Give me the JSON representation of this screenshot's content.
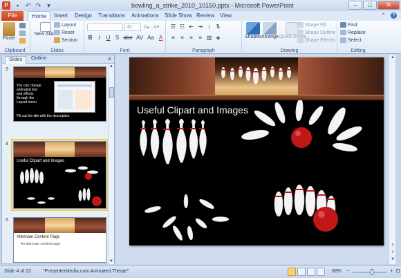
{
  "window": {
    "title": "bowling_a_strike_2010_10150.pptx - Microsoft PowerPoint",
    "controls": [
      "–",
      "□",
      "✕"
    ]
  },
  "tabs": {
    "file": "File",
    "items": [
      "Home",
      "Insert",
      "Design",
      "Transitions",
      "Animations",
      "Slide Show",
      "Review",
      "View"
    ],
    "active": "Home"
  },
  "ribbon": {
    "clipboard": {
      "label": "Clipboard",
      "paste": "Paste"
    },
    "slides": {
      "label": "Slides",
      "new_slide": "New Slide",
      "layout": "Layout",
      "reset": "Reset",
      "section": "Section"
    },
    "font": {
      "label": "Font",
      "size": "40",
      "buttons": [
        "B",
        "I",
        "U",
        "S",
        "abe",
        "AV",
        "Aa",
        "A"
      ]
    },
    "paragraph": {
      "label": "Paragraph"
    },
    "drawing": {
      "label": "Drawing",
      "shapes": "Shapes",
      "arrange": "Arrange",
      "quick_styles": "Quick Styles",
      "shape_fill": "Shape Fill",
      "shape_outline": "Shape Outline",
      "shape_effects": "Shape Effects"
    },
    "editing": {
      "label": "Editing",
      "find": "Find",
      "replace": "Replace",
      "select": "Select"
    }
  },
  "panel": {
    "tabs": [
      "Slides",
      "Outline"
    ],
    "active_tab": "Slides",
    "close": "✕",
    "slides": [
      {
        "number": "3",
        "type": "text-image",
        "text_lines": [
          "You can change",
          "animated text",
          "and effects",
          "through the",
          "Layout menu"
        ],
        "bottom_text": "Fill out the title with the description"
      },
      {
        "number": "4",
        "type": "clipart",
        "title": "Useful Clipart and Images",
        "selected": true
      },
      {
        "number": "5",
        "type": "content",
        "title": "Alternate Content Page",
        "body": "An alternate content page"
      }
    ]
  },
  "main_slide": {
    "title": "Useful Clipart and Images"
  },
  "status": {
    "slide": "Slide 4 of 22",
    "theme": "\"PresenterMedia.com Animated Theme\"",
    "zoom": "68%",
    "zoom_fraction": 0.55
  },
  "colors": {
    "file_tab": "#c5401c",
    "selection": "#f2c84b",
    "ball_red": "#c01818"
  }
}
